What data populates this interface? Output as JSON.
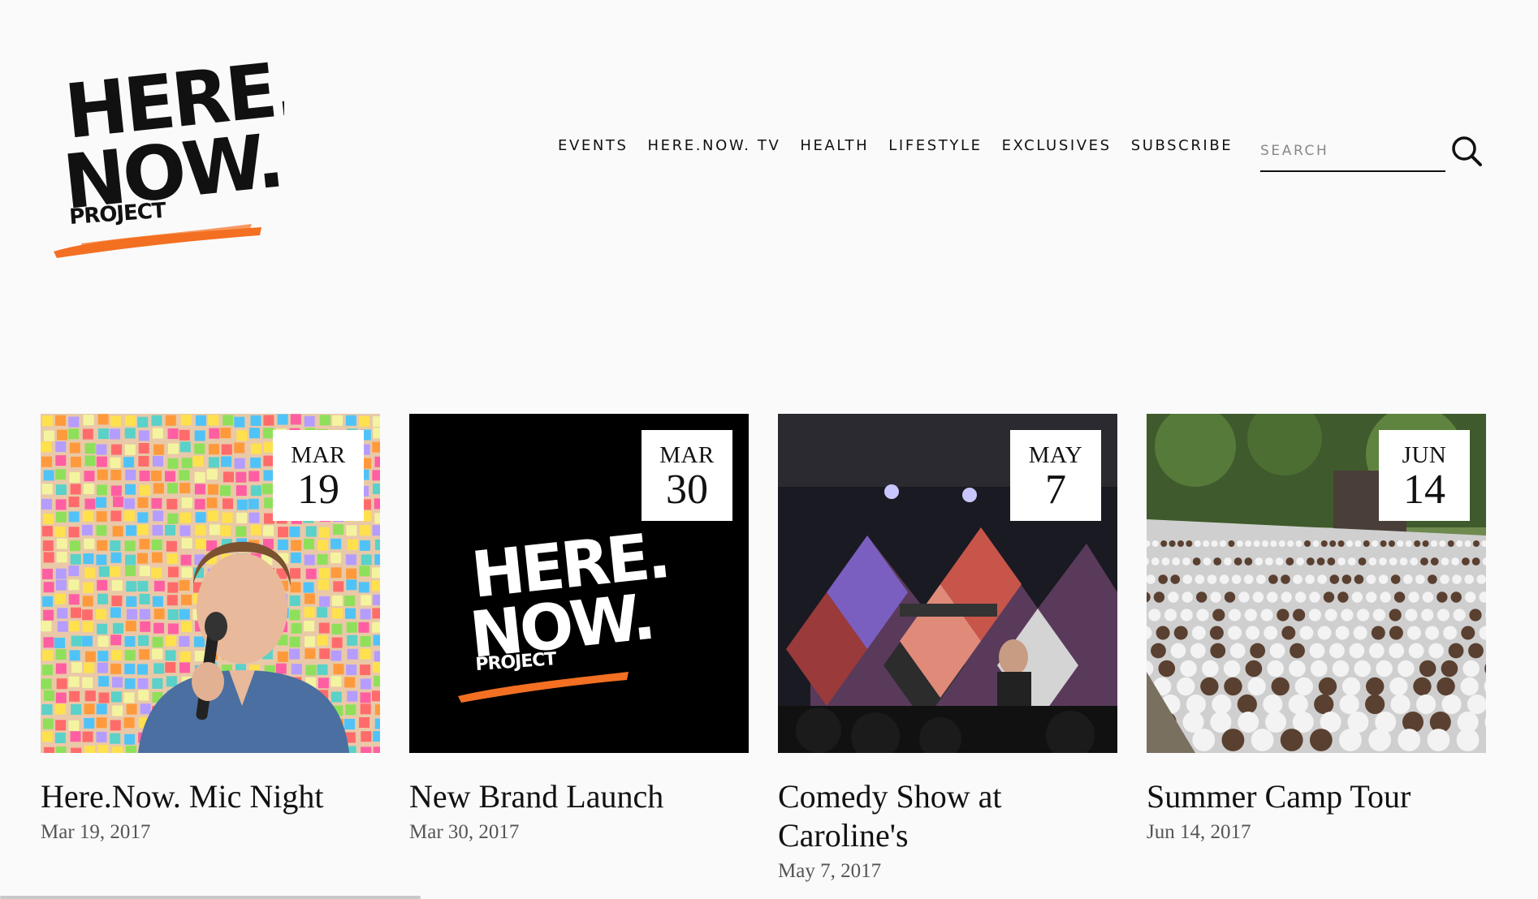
{
  "brand": {
    "logo_word1": "HERE.",
    "logo_word2": "NOW.",
    "logo_word3": "PROJECT",
    "accent_color": "#f36f21",
    "text_color": "#111111"
  },
  "nav": {
    "items": [
      {
        "label": "EVENTS"
      },
      {
        "label": "HERE.NOW. TV"
      },
      {
        "label": "HEALTH"
      },
      {
        "label": "LIFESTYLE"
      },
      {
        "label": "EXCLUSIVES"
      },
      {
        "label": "SUBSCRIBE"
      }
    ]
  },
  "search": {
    "placeholder": "SEARCH",
    "value": "",
    "icon": "search-icon"
  },
  "events": [
    {
      "month": "MAR",
      "day": "19",
      "title": "Here.Now. Mic Night",
      "date": "Mar 19, 2017",
      "image": "sticky-note wall with performer holding microphone"
    },
    {
      "month": "MAR",
      "day": "30",
      "title": "New Brand Launch",
      "date": "Mar 30, 2017",
      "image": "Here.Now. Project logo on black"
    },
    {
      "month": "MAY",
      "day": "7",
      "title": "Comedy Show at Caroline's",
      "date": "May 7, 2017",
      "image": "comedian on stage at Carolines"
    },
    {
      "month": "JUN",
      "day": "14",
      "title": "Summer Camp Tour",
      "date": "Jun 14, 2017",
      "image": "outdoor amphitheater crowd in white shirts"
    }
  ]
}
